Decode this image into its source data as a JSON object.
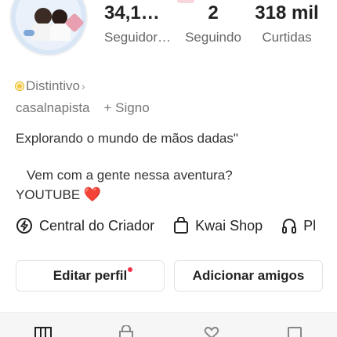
{
  "profile": {
    "stats": [
      {
        "value": "34,1…",
        "label": "Seguidor…"
      },
      {
        "value": "2",
        "label": "Seguindo"
      },
      {
        "value": "318 mil",
        "label": "Curtidas"
      }
    ],
    "badge_label": "Distintivo",
    "username": "casalnapista",
    "sign_label": "+ Signo",
    "bio_line1": "Explorando o mundo de mãos dadas\"",
    "bio_line2": "Vem com a gente nessa aventura?",
    "bio_line3": "YOUTUBE",
    "bio_emoji": "❤️"
  },
  "links": [
    {
      "label": "Central do Criador",
      "icon": "lightning-icon"
    },
    {
      "label": "Kwai Shop",
      "icon": "shopping-bag-icon"
    },
    {
      "label": "Pl",
      "icon": "headphones-icon"
    }
  ],
  "buttons": {
    "edit_profile": "Editar perfil",
    "add_friends": "Adicionar amigos"
  },
  "tabs": [
    "grid-icon",
    "lock-bag-icon",
    "heart-icon",
    "bookmark-icon"
  ],
  "colors": {
    "accent": "#f2314a",
    "badge": "#f3c640"
  }
}
